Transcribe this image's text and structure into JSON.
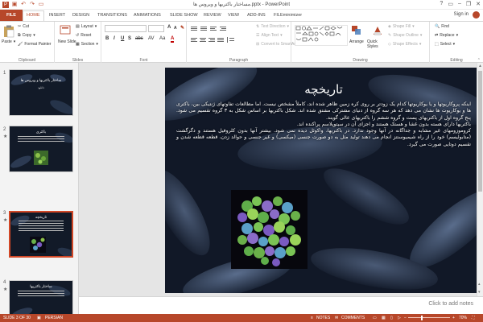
{
  "window": {
    "title": "مساختار باکتریها و ویروس ها.pptx - PowerPoint",
    "controls": [
      "?",
      "▭",
      "–",
      "❐",
      "✕"
    ]
  },
  "tabs": {
    "file": "FILE",
    "items": [
      "HOME",
      "INSERT",
      "DESIGN",
      "TRANSITIONS",
      "ANIMATIONS",
      "SLIDE SHOW",
      "REVIEW",
      "VIEW",
      "ADD-INS",
      "FILEminimizer"
    ],
    "active": "HOME",
    "sign_in": "Sign in"
  },
  "ribbon": {
    "clipboard": {
      "label": "Clipboard",
      "paste": "Paste",
      "cut": "Cut",
      "copy": "Copy",
      "format_painter": "Format Painter"
    },
    "slides": {
      "label": "Slides",
      "new_slide": "New Slide",
      "layout": "Layout",
      "reset": "Reset",
      "section": "Section"
    },
    "font": {
      "label": "Font",
      "buttons": [
        "B",
        "I",
        "U",
        "S",
        "abc",
        "AV",
        "Aa",
        "A"
      ]
    },
    "paragraph": {
      "label": "Paragraph",
      "text_direction": "Text Direction",
      "align_text": "Align Text",
      "convert_smartart": "Convert to SmartArt"
    },
    "drawing": {
      "label": "Drawing",
      "arrange": "Arrange",
      "quick_styles": "Quick Styles",
      "shape_fill": "Shape Fill",
      "shape_outline": "Shape Outline",
      "shape_effects": "Shape Effects"
    },
    "editing": {
      "label": "Editing",
      "find": "Find",
      "replace": "Replace",
      "select": "Select"
    }
  },
  "thumbnails": [
    {
      "num": "1",
      "star": "",
      "title": "ساختار باکتریها و ویروس ها",
      "subtitle": "دانلود",
      "selected": false
    },
    {
      "num": "2",
      "star": "★",
      "title": "باکتری",
      "subtitle": "",
      "selected": false
    },
    {
      "num": "3",
      "star": "★",
      "title": "تاریخچه",
      "subtitle": "",
      "selected": true
    },
    {
      "num": "4",
      "star": "★",
      "title": "ساختار باکتریها",
      "subtitle": "",
      "selected": false
    }
  ],
  "slide": {
    "title": "تاریخچه",
    "paragraphs": [
      "اینکه پروکاریوتها و یا یوکاریوتها کدام یک زودتر بر روی کره زمین ظاهر شده اند، کاملاً مشخص نیست. اما مطالعات تفاوتهای ژنتیکی بین، باکتری ها و یوکاریوت ها نشان می دهد که هر سه گروه از دنیای مشترکی مشتق شده اند. شکل باکتریها بر اساس شکل به ۳ گروه تقسیم می شود. پنج گروه اول از باکتریهای پست و گروه ششم را باکتریهای عالی گویند.",
      "باکتریها دارای هسته بدون غشا و هستک هستند و اجزای آن در سیتوپلاسم پراکنده اند.",
      "کروموزومهای غیر مشابه و جداگانه در آنها وجود ندارد. در باکتریها، واکوئل دیده نمی شود. بیشتر آنها بدون کلروفیل هستند و دگرگشت (متابولیسم) خود را از راه شیمیوسنتز انجام می دهند تولید مثل به دو صورت جنسی (میکسی) و غیر جنسی و حوالد زدن، قطعه قطعه شدن و تقسیم دوتایی صورت می گیرد."
    ]
  },
  "notes": {
    "placeholder": "Click to add notes"
  },
  "status": {
    "slide_info": "SLIDE 3 OF 30",
    "language": "PERSIAN",
    "notes": "NOTES",
    "comments": "COMMENTS",
    "zoom": "70%",
    "zoom_level": 0.7
  },
  "colors": {
    "accent": "#b7472a",
    "slide_bg": "#1b2536"
  }
}
